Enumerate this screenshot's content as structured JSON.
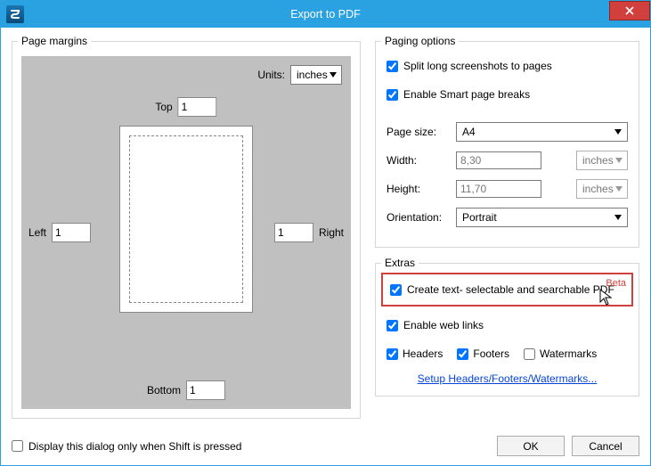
{
  "title": "Export to PDF",
  "close_aria": "Close",
  "margins": {
    "legend": "Page margins",
    "units_label": "Units:",
    "units_value": "inches",
    "top_label": "Top",
    "top_value": "1",
    "bottom_label": "Bottom",
    "bottom_value": "1",
    "left_label": "Left",
    "left_value": "1",
    "right_label": "Right",
    "right_value": "1"
  },
  "paging": {
    "legend": "Paging options",
    "split_label": "Split long screenshots to pages",
    "smart_label": "Enable Smart page breaks",
    "pagesize_label": "Page size:",
    "pagesize_value": "A4",
    "width_label": "Width:",
    "width_value": "8,30",
    "width_unit": "inches",
    "height_label": "Height:",
    "height_value": "11,70",
    "height_unit": "inches",
    "orientation_label": "Orientation:",
    "orientation_value": "Portrait"
  },
  "extras": {
    "legend": "Extras",
    "beta_tag": "Beta",
    "searchable_label": "Create text- selectable and searchable PDF",
    "weblinks_label": "Enable web links",
    "headers_label": "Headers",
    "footers_label": "Footers",
    "watermarks_label": "Watermarks",
    "setup_link": "Setup Headers/Footers/Watermarks..."
  },
  "bottom": {
    "shift_label": "Display this dialog only when Shift is pressed",
    "ok": "OK",
    "cancel": "Cancel"
  }
}
